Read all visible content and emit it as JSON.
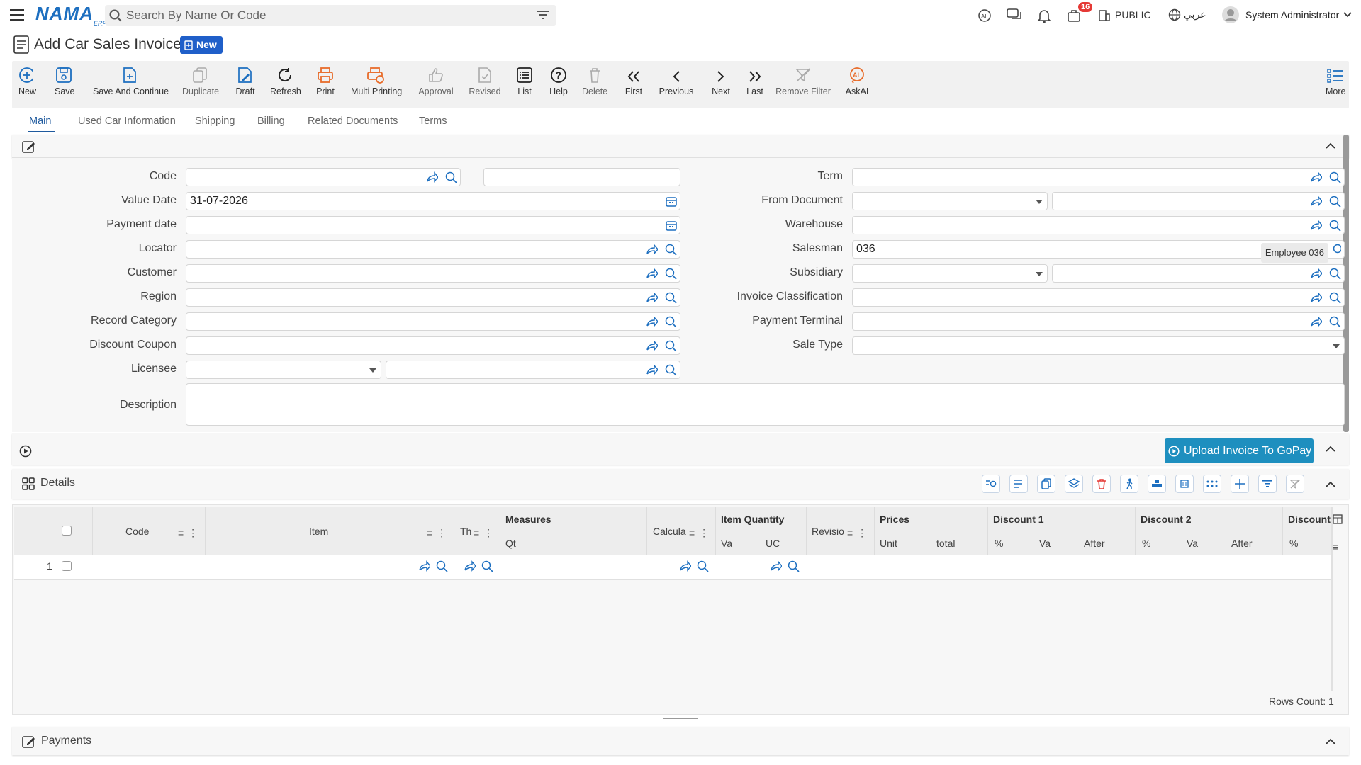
{
  "topbar": {
    "logo_main": "NAMA",
    "logo_sub": "ERP",
    "search_placeholder": "Search By Name Or Code",
    "notification_count": "16",
    "company": "PUBLIC",
    "language": "عربي",
    "user": "System Administrator"
  },
  "page": {
    "title": "Add Car Sales Invoice",
    "badge": "New"
  },
  "toolbar": {
    "new": "New",
    "save": "Save",
    "save_continue": "Save And Continue",
    "duplicate": "Duplicate",
    "draft": "Draft",
    "refresh": "Refresh",
    "print": "Print",
    "multi_printing": "Multi Printing",
    "approval": "Approval",
    "revised": "Revised",
    "list": "List",
    "help": "Help",
    "delete": "Delete",
    "first": "First",
    "previous": "Previous",
    "next": "Next",
    "last": "Last",
    "remove_filter": "Remove Filter",
    "askai": "AskAI",
    "more": "More"
  },
  "tabs": [
    "Main",
    "Used Car Information",
    "Shipping",
    "Billing",
    "Related Documents",
    "Terms"
  ],
  "form_left": {
    "code": "Code",
    "value_date": "Value Date",
    "value_date_val": "31-07-2026",
    "payment_date": "Payment date",
    "locator": "Locator",
    "customer": "Customer",
    "region": "Region",
    "record_category": "Record Category",
    "discount_coupon": "Discount Coupon",
    "licensee": "Licensee",
    "description": "Description"
  },
  "form_right": {
    "term": "Term",
    "from_document": "From Document",
    "warehouse": "Warehouse",
    "salesman": "Salesman",
    "salesman_val": "036",
    "salesman_name": "Employee 036",
    "subsidiary": "Subsidiary",
    "invoice_classification": "Invoice Classification",
    "payment_terminal": "Payment Terminal",
    "sale_type": "Sale Type"
  },
  "gopay_button": "Upload Invoice To GoPay",
  "details": {
    "title": "Details",
    "headers": {
      "code": "Code",
      "item": "Item",
      "th": "Th",
      "measures": "Measures",
      "qty": "Qt",
      "calc": "Calcula",
      "item_quantity": "Item Quantity",
      "va": "Va",
      "uc": "UC",
      "revision": "Revisio",
      "prices": "Prices",
      "unit": "Unit",
      "total": "total",
      "discount1": "Discount 1",
      "discount2": "Discount 2",
      "discount3": "Discount",
      "pct": "%",
      "va2": "Va",
      "after": "After"
    },
    "row_number": "1",
    "rows_count": "Rows Count: 1"
  },
  "payments": {
    "title": "Payments"
  }
}
